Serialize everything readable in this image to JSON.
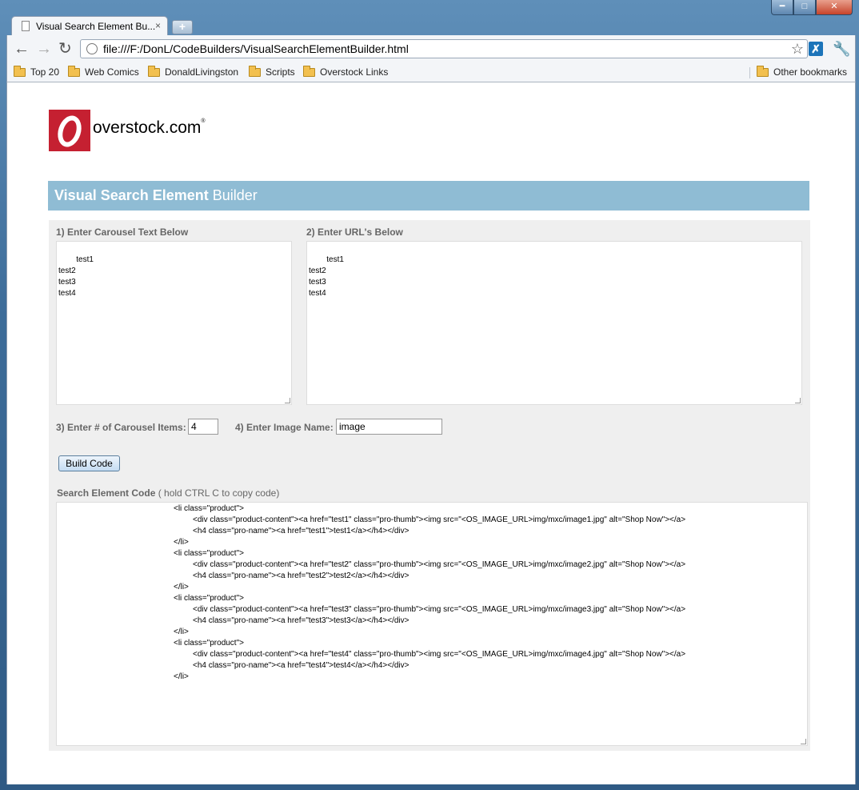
{
  "browser": {
    "tab_title": "Visual Search Element Bu...",
    "tab_close": "×",
    "new_tab": "+",
    "url": "file:///F:/DonL/CodeBuilders/VisualSearchElementBuilder.html",
    "icons": [
      "back-icon",
      "forward-icon",
      "reload-icon",
      "globe-icon",
      "star-icon",
      "extension-icon",
      "wrench-icon"
    ],
    "window_controls": [
      "minimize",
      "maximize",
      "close"
    ]
  },
  "bookmarks": {
    "items": [
      "Top 20",
      "Web Comics",
      "DonaldLivingston",
      "Scripts",
      "Overstock Links"
    ],
    "other": "Other bookmarks"
  },
  "page": {
    "logo_text": "overstock.com",
    "logo_mark": "®",
    "title_bold": "Visual Search Element",
    "title_rest": " Builder",
    "colors": {
      "title_bar": "#8fbcd4",
      "logo_red": "#c52031",
      "panel": "#efefef"
    },
    "step1_label": "1) Enter Carousel Text Below",
    "step1_text": "test1\ntest2\ntest3\ntest4",
    "step2_label": "2) Enter URL's Below",
    "step2_text": "test1\ntest2\ntest3\ntest4",
    "step3_label": "3) Enter # of Carousel Items:",
    "step3_value": "4",
    "step4_label": "4) Enter Image Name:",
    "step4_value": "image",
    "build_button": "Build Code",
    "code_label_bold": "Search Element Code",
    "code_label_hint": " ( hold CTRL C to copy code)",
    "code_lines": [
      {
        "indent": 0,
        "text": "<li class=\"product\">"
      },
      {
        "indent": 1,
        "text": "<div class=\"product-content\"><a href=\"test1\" class=\"pro-thumb\"><img src=\"<OS_IMAGE_URL>img/mxc/image1.jpg\" alt=\"Shop Now\"></a>"
      },
      {
        "indent": 1,
        "text": "<h4 class=\"pro-name\"><a href=\"test1\">test1</a></h4></div>"
      },
      {
        "indent": 0,
        "text": "</li>"
      },
      {
        "indent": 0,
        "text": "<li class=\"product\">"
      },
      {
        "indent": 1,
        "text": "<div class=\"product-content\"><a href=\"test2\" class=\"pro-thumb\"><img src=\"<OS_IMAGE_URL>img/mxc/image2.jpg\" alt=\"Shop Now\"></a>"
      },
      {
        "indent": 1,
        "text": "<h4 class=\"pro-name\"><a href=\"test2\">test2</a></h4></div>"
      },
      {
        "indent": 0,
        "text": "</li>"
      },
      {
        "indent": 0,
        "text": "<li class=\"product\">"
      },
      {
        "indent": 1,
        "text": "<div class=\"product-content\"><a href=\"test3\" class=\"pro-thumb\"><img src=\"<OS_IMAGE_URL>img/mxc/image3.jpg\" alt=\"Shop Now\"></a>"
      },
      {
        "indent": 1,
        "text": "<h4 class=\"pro-name\"><a href=\"test3\">test3</a></h4></div>"
      },
      {
        "indent": 0,
        "text": "</li>"
      },
      {
        "indent": 0,
        "text": "<li class=\"product\">"
      },
      {
        "indent": 1,
        "text": "<div class=\"product-content\"><a href=\"test4\" class=\"pro-thumb\"><img src=\"<OS_IMAGE_URL>img/mxc/image4.jpg\" alt=\"Shop Now\"></a>"
      },
      {
        "indent": 1,
        "text": "<h4 class=\"pro-name\"><a href=\"test4\">test4</a></h4></div>"
      },
      {
        "indent": 0,
        "text": "</li>"
      }
    ]
  }
}
